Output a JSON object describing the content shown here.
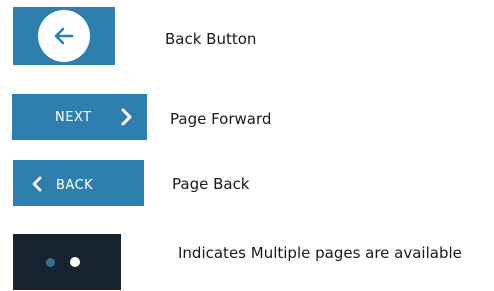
{
  "colors": {
    "button_blue": "#2e7fad",
    "dots_background": "#152430",
    "inactive_dot": "#3a6e90",
    "active_dot": "#ffffff"
  },
  "legend": [
    {
      "icon": "arrow-left-icon",
      "button_text": "",
      "description": "Back Button"
    },
    {
      "icon": "chevron-right-icon",
      "button_text": "NEXT",
      "description": "Page Forward"
    },
    {
      "icon": "chevron-left-icon",
      "button_text": "BACK",
      "description": "Page Back"
    },
    {
      "icon": "page-dots-icon",
      "button_text": "",
      "description": "Indicates Multiple pages are available",
      "total_dots": 2,
      "active_dot": 2
    }
  ]
}
